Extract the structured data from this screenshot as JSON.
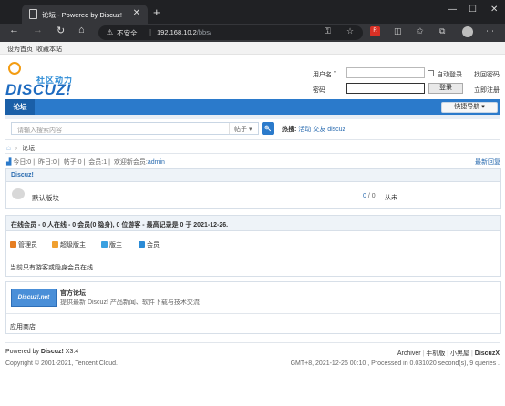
{
  "browser": {
    "tab_title": "论坛 - Powered by Discuz!",
    "tab_close": "✕",
    "new_tab": "+",
    "window_min": "—",
    "window_max": "☐",
    "window_close": "✕",
    "nav_back": "←",
    "nav_forward": "→",
    "nav_reload": "↻",
    "nav_home": "⌂",
    "security_icon": "⚠",
    "security_label": "不安全",
    "url_host": "192.168.10.2",
    "url_path": "/bbs/",
    "ext_badge": "R"
  },
  "topnav": {
    "set_home": "设为首页",
    "bookmark": "收藏本站"
  },
  "logo": {
    "cn": "社区动力",
    "word": "DISCUZ!"
  },
  "login": {
    "username_label": "用户名",
    "password_label": "密码",
    "auto_login": "自动登录",
    "find_password": "找回密码",
    "login_button": "登录",
    "register": "立即注册"
  },
  "nav": {
    "tab": "论坛",
    "quick_nav": "快捷导航 ▾"
  },
  "search": {
    "placeholder": "请输入搜索内容",
    "scope": "帖子 ▾",
    "button_icon": "🔍",
    "hot_label": "热搜:",
    "hot_items": [
      "活动",
      "交友",
      "discuz"
    ]
  },
  "breadcrumb": {
    "home_icon": "⌂",
    "arrow": "›",
    "current": "论坛"
  },
  "stats": {
    "today_label": "今日:",
    "today": "0",
    "yesterday_label": "昨日:",
    "yesterday": "0",
    "posts_label": "帖子:",
    "posts": "0",
    "members_label": "会员:",
    "members": "1",
    "welcome_label": "欢迎新会员:",
    "new_member": "admin",
    "latest_replies": "最新回复"
  },
  "category": {
    "name": "Discuz!",
    "forums": [
      {
        "name": "默认版块",
        "threads": "0",
        "posts": "0",
        "last": "从未"
      }
    ]
  },
  "online": {
    "header": "在线会员 - 0 人在线 - 0 会员(0 隐身), 0 位游客 - 最高记录是 0 于 2021-12-26.",
    "roles": [
      "管理员",
      "超级版主",
      "版主",
      "会员"
    ],
    "role_colors": [
      "#e67e22",
      "#e67e22",
      "#3aa0e0",
      "#2b8bd6"
    ],
    "empty_text": "当前只有游客或隐身会员在线"
  },
  "links": {
    "logo_text": "Discuz!.net",
    "title": "官方论坛",
    "description": "提供最新 Discuz! 产品新闻、软件下载与技术交流",
    "app_store": "应用商店"
  },
  "footer": {
    "powered_prefix": "Powered by ",
    "powered_brand": "Discuz!",
    "version": " X3.4",
    "copyright": "Copyright © 2001-2021, Tencent Cloud.",
    "links": [
      "Archiver",
      "手机版",
      "小黑屋",
      "DiscuzX"
    ],
    "runtime": "GMT+8, 2021-12-26 00:10 , Processed in 0.031020 second(s), 9 queries ."
  }
}
